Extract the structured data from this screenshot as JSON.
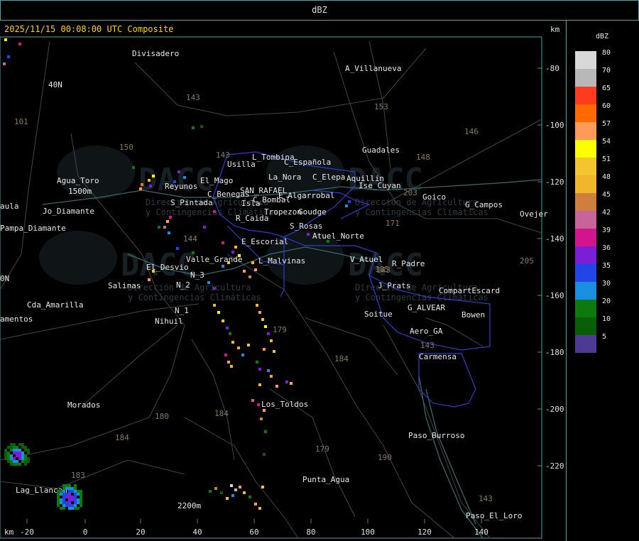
{
  "window": {
    "title": "dBZ"
  },
  "header": {
    "timestamp": "2025/11/15 00:08:00 UTC Composite",
    "unit_top": "km",
    "unit_bottom": "km"
  },
  "x_ticks": [
    "-20",
    "0",
    "20",
    "40",
    "60",
    "80",
    "100",
    "120",
    "140"
  ],
  "y_ticks": [
    "-80",
    "-100",
    "-120",
    "-140",
    "-160",
    "-180",
    "-200",
    "-220"
  ],
  "legend": {
    "title": "dBZ",
    "items": [
      {
        "label": "80",
        "color": "#d8d8d8"
      },
      {
        "label": "70",
        "color": "#b8b8b8"
      },
      {
        "label": "65",
        "color": "#ff3b1f"
      },
      {
        "label": "60",
        "color": "#ff6a00"
      },
      {
        "label": "57",
        "color": "#ff9a5a"
      },
      {
        "label": "54",
        "color": "#ffff00"
      },
      {
        "label": "51",
        "color": "#f5c431"
      },
      {
        "label": "48",
        "color": "#f2b62c"
      },
      {
        "label": "45",
        "color": "#cf7f3c"
      },
      {
        "label": "42",
        "color": "#c8649a"
      },
      {
        "label": "39",
        "color": "#d2148e"
      },
      {
        "label": "36",
        "color": "#7a1fd6"
      },
      {
        "label": "35",
        "color": "#2246e6"
      },
      {
        "label": "30",
        "color": "#1a8fe0"
      },
      {
        "label": "20",
        "color": "#0c7a0c"
      },
      {
        "label": "10",
        "color": "#0a5e0a"
      },
      {
        "label": "5",
        "color": "#4d3a94"
      }
    ]
  },
  "places": [
    {
      "t": "Divisadero"
    },
    {
      "t": "A_Villanueva"
    },
    {
      "t": "40N"
    },
    {
      "t": "Guadales"
    },
    {
      "t": "L_Tombina"
    },
    {
      "t": "Usilla"
    },
    {
      "t": "C_Española"
    },
    {
      "t": "La_Nora"
    },
    {
      "t": "C_Elepa"
    },
    {
      "t": "Aquillin"
    },
    {
      "t": "Agua_Toro"
    },
    {
      "t": "1500m"
    },
    {
      "t": "Jo_Diamante"
    },
    {
      "t": "Pampa_Diamante"
    },
    {
      "t": "Reyunos"
    },
    {
      "t": "El_Mago"
    },
    {
      "t": "C_Benegas"
    },
    {
      "t": "SAN_RAFAEL"
    },
    {
      "t": "E_Algarrobal"
    },
    {
      "t": "C_Bombal"
    },
    {
      "t": "Ise_Cuyan"
    },
    {
      "t": "Goico"
    },
    {
      "t": "G_Campos"
    },
    {
      "t": "Ovejer"
    },
    {
      "t": "S_Pintada"
    },
    {
      "t": "Isla"
    },
    {
      "t": "R_Caida"
    },
    {
      "t": "Tropezon"
    },
    {
      "t": "Goudge"
    },
    {
      "t": "S_Rosas"
    },
    {
      "t": "Atuel_Norte"
    },
    {
      "t": "E_Escorial"
    },
    {
      "t": "Valle_Grande"
    },
    {
      "t": "L_Malvinas"
    },
    {
      "t": "El_Desvio"
    },
    {
      "t": "V_Atuel"
    },
    {
      "t": "R_Padre"
    },
    {
      "t": "Salinas"
    },
    {
      "t": "N_2"
    },
    {
      "t": "N_3"
    },
    {
      "t": "J_Prats"
    },
    {
      "t": "CompartEscard"
    },
    {
      "t": "Cda_Amarilla"
    },
    {
      "t": "amentos"
    },
    {
      "t": "N_1"
    },
    {
      "t": "Nihuil"
    },
    {
      "t": "G_ALVEAR"
    },
    {
      "t": "Soitue"
    },
    {
      "t": "Bowen"
    },
    {
      "t": "Aero_GA"
    },
    {
      "t": "Carmensa"
    },
    {
      "t": "Morados"
    },
    {
      "t": "Los_Toldos"
    },
    {
      "t": "Paso_Burroso"
    },
    {
      "t": "Lag_Llancan"
    },
    {
      "t": "Punta_Agua"
    },
    {
      "t": "2200m"
    },
    {
      "t": "Paso_El_Loro"
    },
    {
      "t": "aula"
    },
    {
      "t": "0N"
    }
  ],
  "road_numbers": [
    "143",
    "153",
    "146",
    "101",
    "150",
    "143",
    "148",
    "203",
    "171",
    "144",
    "143",
    "185",
    "179",
    "184",
    "180",
    "184",
    "184",
    "179",
    "190",
    "183",
    "143",
    "143",
    "205"
  ],
  "watermarks": [
    "DACC",
    "DACC",
    "DACC",
    "DACC"
  ],
  "watermark_lines": [
    "Dirección de Agricultura",
    "y Contingencias Climáticas"
  ]
}
